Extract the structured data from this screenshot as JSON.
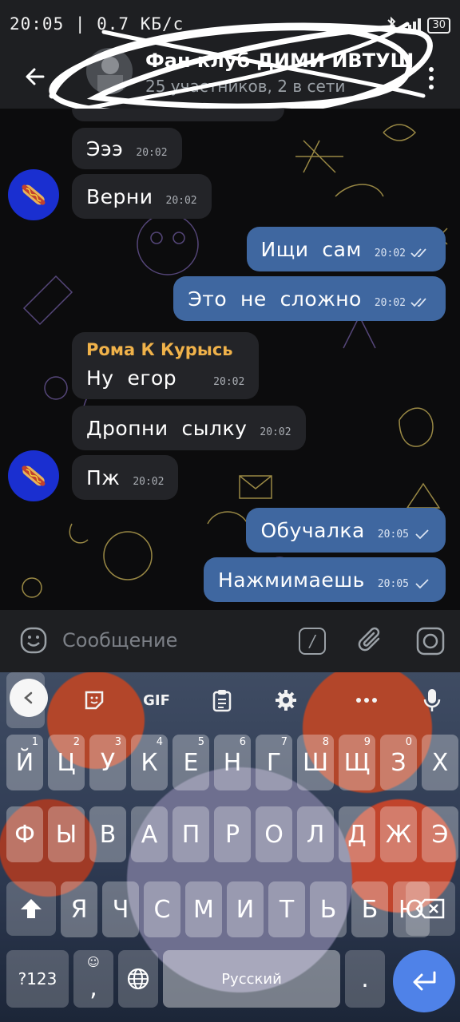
{
  "status_bar": {
    "time_and_speed": "20:05 | 0.7 КБ/с",
    "battery": "30"
  },
  "header": {
    "title": "Фан клуб ДИМИ ИВТУШ",
    "subtitle": "25 участников, 2 в сети"
  },
  "messages": [
    {
      "text": "Эээ",
      "time": "20:02"
    },
    {
      "text": "Верни",
      "time": "20:02"
    },
    {
      "text": "Ищи  сам",
      "time": "20:02"
    },
    {
      "text": "Это  не  сложно",
      "time": "20:02"
    },
    {
      "sender": "Рома К Курысь",
      "text": "Ну  егор",
      "time": "20:02"
    },
    {
      "text": "Дропни  сылку",
      "time": "20:02"
    },
    {
      "text": "Пж",
      "time": "20:02"
    },
    {
      "text": "Обучалка",
      "time": "20:05"
    },
    {
      "text": "Нажмимаешь",
      "time": "20:05"
    }
  ],
  "composer": {
    "placeholder": "Сообщение",
    "command_glyph": "/"
  },
  "keyboard": {
    "gif": "GIF",
    "row1": [
      [
        "Й",
        "1"
      ],
      [
        "Ц",
        "2"
      ],
      [
        "У",
        "3"
      ],
      [
        "К",
        "4"
      ],
      [
        "Е",
        "5"
      ],
      [
        "Н",
        "6"
      ],
      [
        "Г",
        "7"
      ],
      [
        "Ш",
        "8"
      ],
      [
        "Щ",
        "9"
      ],
      [
        "З",
        "0"
      ],
      [
        "Х",
        ""
      ]
    ],
    "row2": [
      "Ф",
      "Ы",
      "В",
      "А",
      "П",
      "Р",
      "О",
      "Л",
      "Д",
      "Ж",
      "Э"
    ],
    "row3": [
      "Я",
      "Ч",
      "С",
      "М",
      "И",
      "Т",
      "Ь",
      "Б",
      "Ю"
    ],
    "numbers_key": "?123",
    "comma": ",",
    "space_label": "Русский",
    "period": "."
  },
  "colors": {
    "outgoing_bubble": "#3f67a0",
    "incoming_bubble": "#232428",
    "sender_name": "#f0b24a",
    "enter_key": "#4f82e8"
  }
}
